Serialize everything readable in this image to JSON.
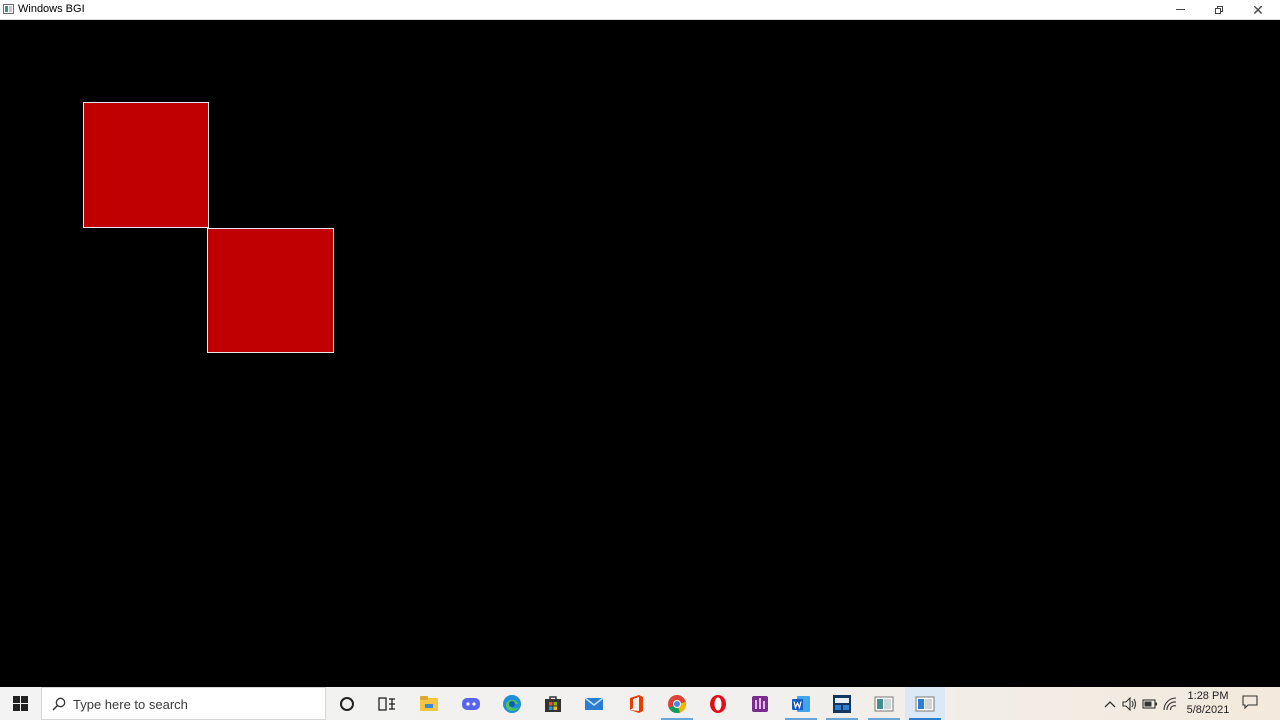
{
  "window": {
    "title": "Windows BGI"
  },
  "canvas": {
    "background": "#000000",
    "square_fill": "#c00000",
    "square_border": "#e6e6e6"
  },
  "taskbar": {
    "search_placeholder": "Type here to search",
    "clock_time": "1:28 PM",
    "clock_date": "5/8/2021",
    "pinned_icons": [
      "cortana-icon",
      "task-view-icon",
      "file-explorer-icon",
      "discord-icon",
      "edge-icon",
      "store-icon",
      "mail-icon",
      "office-icon",
      "chrome-icon",
      "opera-icon",
      "equalizer-app-icon",
      "word-icon",
      "dev-app-icon",
      "bgi-console-icon",
      "windows-bgi-icon"
    ]
  }
}
